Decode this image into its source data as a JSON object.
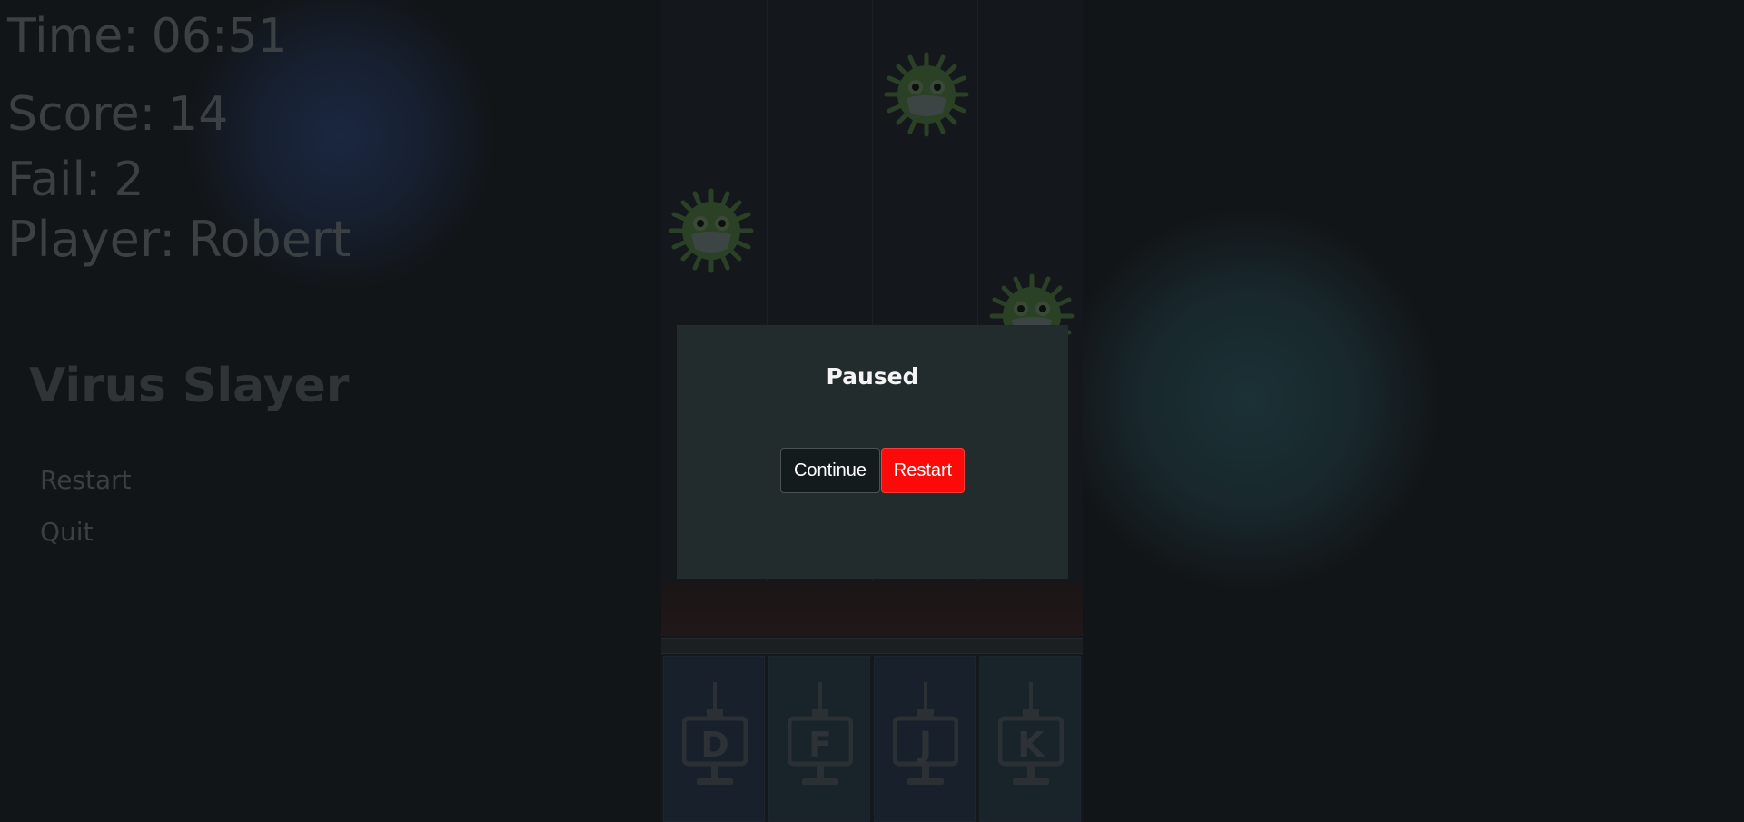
{
  "hud": {
    "time_label": "Time:",
    "time_value": "06:51",
    "score_label": "Score:",
    "score_value": "14",
    "fail_label": "Fail:",
    "fail_value": "2",
    "player_label": "Player:",
    "player_value": "Robert"
  },
  "sidebar": {
    "title": "Virus Slayer",
    "menu": [
      {
        "label": "Restart"
      },
      {
        "label": "Quit"
      }
    ]
  },
  "board": {
    "keys": [
      "D",
      "F",
      "J",
      "K"
    ],
    "viruses": [
      {
        "lane": 3,
        "icon": "masked-virus-icon"
      },
      {
        "lane": 1,
        "icon": "masked-virus-icon"
      },
      {
        "lane": 4,
        "icon": "masked-virus-icon"
      }
    ]
  },
  "pause_dialog": {
    "title": "Paused",
    "continue_label": "Continue",
    "restart_label": "Restart"
  },
  "colors": {
    "background": "#121518",
    "modal": "#232c2c",
    "restart_button": "#fc0a0a",
    "continue_button": "#141b1c",
    "virus_green": "#2b4126"
  }
}
